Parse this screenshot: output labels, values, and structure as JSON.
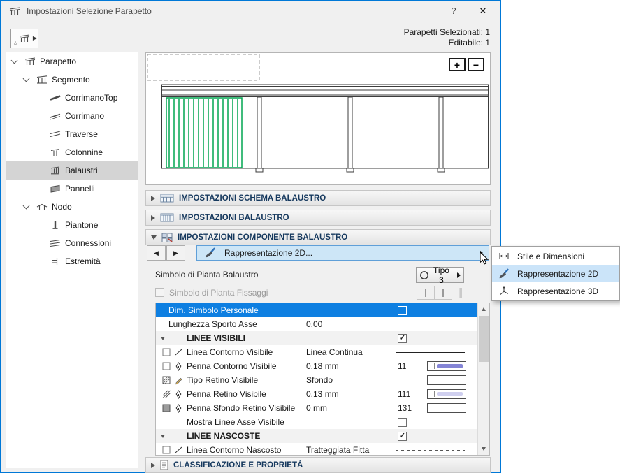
{
  "window": {
    "title": "Impostazioni Selezione Parapetto",
    "help_label": "?",
    "close_label": "✕"
  },
  "header": {
    "selected_count": "Parapetti Selezionati: 1",
    "editable_count": "Editabile: 1"
  },
  "colors": {
    "accent_blue": "#0078d7",
    "selection_blue": "#0e7fe1",
    "baluster_green": "#00a651",
    "highlight_blue": "#cde6f7"
  },
  "tree": {
    "items": [
      {
        "label": "Parapetto",
        "level": 0,
        "icon": "railing",
        "expanded": true
      },
      {
        "label": "Segmento",
        "level": 1,
        "icon": "segment",
        "expanded": true
      },
      {
        "label": "CorrimanoTop",
        "level": 2,
        "icon": "toprail"
      },
      {
        "label": "Corrimano",
        "level": 2,
        "icon": "handrail"
      },
      {
        "label": "Traverse",
        "level": 2,
        "icon": "rail"
      },
      {
        "label": "Colonnine",
        "level": 2,
        "icon": "inner-post"
      },
      {
        "label": "Balaustri",
        "level": 2,
        "icon": "balusters",
        "selected": true
      },
      {
        "label": "Pannelli",
        "level": 2,
        "icon": "panel"
      },
      {
        "label": "Nodo",
        "level": 1,
        "icon": "node",
        "expanded": true
      },
      {
        "label": "Piantone",
        "level": 2,
        "icon": "post"
      },
      {
        "label": "Connessioni",
        "level": 2,
        "icon": "connections"
      },
      {
        "label": "Estremità",
        "level": 2,
        "icon": "ending"
      }
    ]
  },
  "preview": {
    "zoom_in_label": "+",
    "zoom_out_label": "−"
  },
  "sections": [
    {
      "label": "IMPOSTAZIONI SCHEMA BALAUSTRO",
      "expanded": false
    },
    {
      "label": "IMPOSTAZIONI BALAUSTRO",
      "expanded": false
    },
    {
      "label": "IMPOSTAZIONI COMPONENTE BALAUSTRO",
      "expanded": true
    },
    {
      "label": "CLASSIFICAZIONE E PROPRIETÀ",
      "expanded": false
    }
  ],
  "component_panel": {
    "page_selector_value": "Rappresentazione 2D...",
    "symbol_label": "Simbolo di Pianta Balaustro",
    "type_button_label": "Tipo 3",
    "fissaggi_label": "Simbolo di Pianta Fissaggi"
  },
  "context_menu": {
    "items": [
      {
        "label": "Stile e Dimensioni",
        "icon": "dimensions",
        "selected": false
      },
      {
        "label": "Rappresentazione 2D",
        "icon": "brush-2d",
        "selected": true
      },
      {
        "label": "Rappresentazione 3D",
        "icon": "cube-3d",
        "selected": false
      }
    ]
  },
  "table": {
    "rows": [
      {
        "type": "selected",
        "label": "Dim. Simbolo Personale",
        "checked": false
      },
      {
        "type": "value",
        "label": "Lunghezza Sporto Asse",
        "value": "0,00"
      },
      {
        "type": "group",
        "label": "LINEE VISIBILI",
        "checked": true
      },
      {
        "type": "prop",
        "icons": [
          "checkbox-empty",
          "line-diagonal"
        ],
        "label": "Linea Contorno Visibile",
        "value": "Linea Continua",
        "control": "line-solid"
      },
      {
        "type": "prop",
        "icons": [
          "checkbox-empty",
          "pen-nib"
        ],
        "label": "Penna Contorno Visibile",
        "value": "0.18 mm",
        "pen": "11",
        "control": "swatch",
        "swatch_bar": "#8585d6"
      },
      {
        "type": "prop",
        "icons": [
          "hatch-box",
          "pencil"
        ],
        "label": "Tipo Retino Visibile",
        "value": "Sfondo",
        "control": "swatch",
        "swatch_bar": null
      },
      {
        "type": "prop",
        "icons": [
          "hatch-lines",
          "pen-nib"
        ],
        "label": "Penna Retino Visibile",
        "value": "0.13 mm",
        "pen": "111",
        "control": "swatch",
        "swatch_bar": "#cfcfef"
      },
      {
        "type": "prop",
        "icons": [
          "gray-box",
          "pen-nib"
        ],
        "label": "Penna Sfondo Retino Visibile",
        "value": "0 mm",
        "pen": "131",
        "control": "swatch",
        "swatch_bar": null
      },
      {
        "type": "check",
        "label": "Mostra Linee Asse Visibile",
        "checked": false
      },
      {
        "type": "group",
        "label": "LINEE NASCOSTE",
        "checked": true
      },
      {
        "type": "prop",
        "icons": [
          "checkbox-empty",
          "line-diagonal"
        ],
        "label": "Linea Contorno Nascosto",
        "value": "Tratteggiata Fitta",
        "control": "line-dashed"
      }
    ]
  }
}
